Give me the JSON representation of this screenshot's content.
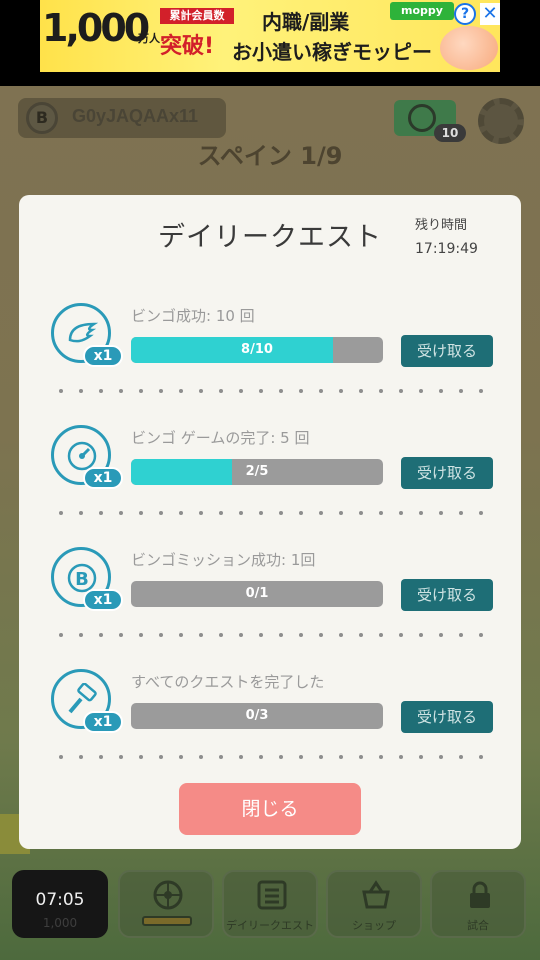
{
  "ad": {
    "count": "1,000",
    "unit": "万人",
    "tag": "累計会員数",
    "break": "突破!",
    "line1": "内職/副業",
    "line2": "お小遣い稼ぎモッピー",
    "brand": "moppy",
    "info": "?",
    "close": "✕"
  },
  "header": {
    "player_initial": "B",
    "player_name": "G0yJAQAAx11",
    "ticket_count": "10",
    "stage_title": "スペイン 1/9"
  },
  "modal": {
    "title": "デイリークエスト",
    "remaining_label": "残り時間",
    "remaining_value": "17:19:49",
    "quests": [
      {
        "text": "ビンゴ成功: 10 回",
        "progress_label": "8/10",
        "progress": 0.8,
        "badge": "x1",
        "button": "受け取る",
        "icon": "wing-icon"
      },
      {
        "text": "ビンゴ ゲームの完了: 5 回",
        "progress_label": "2/5",
        "progress": 0.4,
        "badge": "x1",
        "button": "受け取る",
        "icon": "speedometer-icon"
      },
      {
        "text": "ビンゴミッション成功: 1回",
        "progress_label": "0/1",
        "progress": 0.0,
        "badge": "x1",
        "button": "受け取る",
        "icon": "bingo-coin-icon"
      },
      {
        "text": "すべてのクエストを完了した",
        "progress_label": "0/3",
        "progress": 0.0,
        "badge": "x1",
        "button": "受け取る",
        "icon": "hammer-icon"
      }
    ],
    "close_label": "閉じる"
  },
  "nav": {
    "timer": "07:05",
    "coins": "1,000",
    "daily": "デイリークエスト",
    "shop": "ショップ",
    "match": "試合"
  },
  "colors": {
    "accent": "#2a9ab8",
    "progress": "#2fd1d1",
    "claim": "#1e6e76",
    "close": "#f58b87"
  }
}
